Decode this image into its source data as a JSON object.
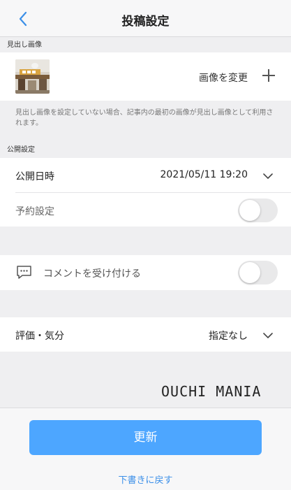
{
  "header": {
    "title": "投稿設定"
  },
  "thumbnail_section": {
    "label": "見出し画像",
    "change_label": "画像を変更",
    "hint": "見出し画像を設定していない場合、記事内の最初の画像が見出し画像として利用されます。"
  },
  "publish_section": {
    "label": "公開設定",
    "datetime_label": "公開日時",
    "datetime_value": "2021/05/11 19:20",
    "schedule_label": "予約設定",
    "schedule_on": false
  },
  "comments": {
    "label": "コメントを受け付ける",
    "enabled": false
  },
  "rating": {
    "label": "評価・気分",
    "value": "指定なし"
  },
  "watermark": "OUCHI MANIA",
  "footer": {
    "update_label": "更新",
    "back_label": "下書きに戻す"
  },
  "colors": {
    "accent": "#4da6ff",
    "link": "#3b8fe8",
    "background": "#efeff1"
  }
}
